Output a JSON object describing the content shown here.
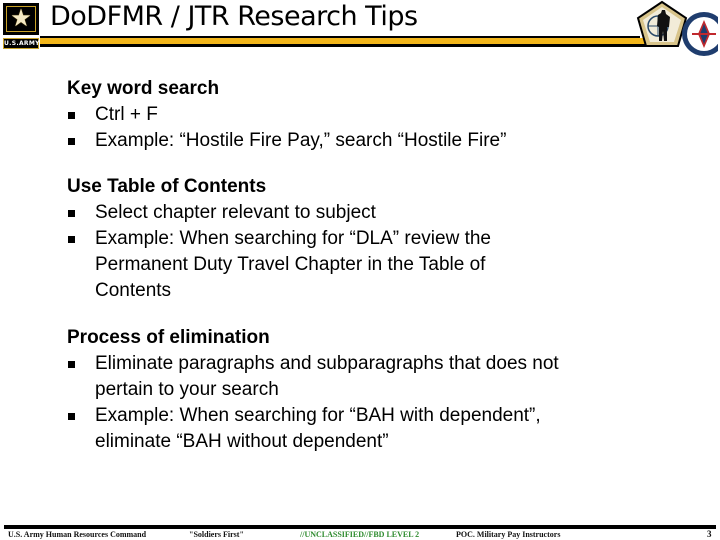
{
  "header": {
    "title": "DoDFMR / JTR Research Tips",
    "army_logo_plate": "U.S.ARMY",
    "army_logo_icon": "army-star-icon",
    "right_logo_1_icon": "hrc-pentagon-soldier-icon",
    "right_logo_2_icon": "circular-seal-icon",
    "stripe_colors": {
      "black": "#000000",
      "gold": "#f2b61b"
    }
  },
  "sections": [
    {
      "heading": "Key word search",
      "bullets": [
        [
          "Ctrl + F"
        ],
        [
          "Example:  “Hostile Fire Pay,” search “Hostile Fire”"
        ]
      ]
    },
    {
      "heading": "Use Table of Contents",
      "bullets": [
        [
          "Select chapter relevant to subject"
        ],
        [
          "Example:  When searching for “DLA” review the",
          "Permanent Duty Travel Chapter in the Table of",
          "Contents"
        ]
      ]
    },
    {
      "heading": "Process of elimination",
      "bullets": [
        [
          "Eliminate paragraphs and subparagraphs that does not",
          "pertain to your search"
        ],
        [
          "Example:  When searching for “BAH with dependent”,",
          "eliminate “BAH without dependent”"
        ]
      ]
    }
  ],
  "footer": {
    "organization": "U.S. Army Human Resources Command",
    "motto": "\"Soldiers First\"",
    "classification": "//UNCLASSIFIED//FBD LEVEL 2",
    "poc": "POC. Military Pay Instructors",
    "page_number": "3",
    "classification_color": "#2e8b2e"
  }
}
